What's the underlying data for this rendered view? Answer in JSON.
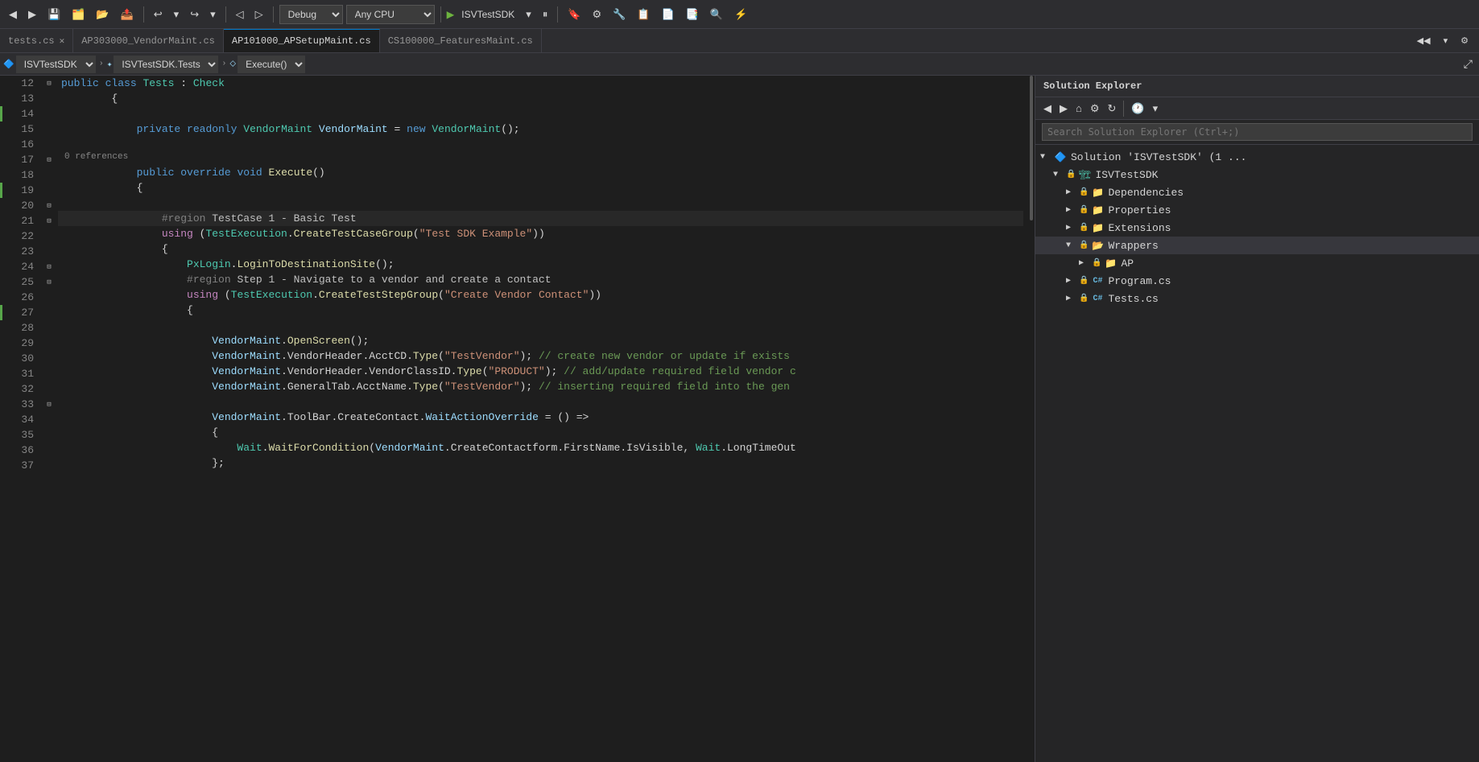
{
  "toolbar": {
    "undo_label": "↩",
    "redo_label": "↪",
    "config_label": "Debug",
    "platform_label": "Any CPU",
    "run_label": "▶",
    "project_label": "ISVTestSDK",
    "save_label": "💾"
  },
  "tabs": [
    {
      "id": "tests",
      "label": "tests.cs",
      "active": false,
      "has_close": true
    },
    {
      "id": "ap303000",
      "label": "AP303000_VendorMaint.cs",
      "active": false,
      "has_close": false
    },
    {
      "id": "ap101000",
      "label": "AP101000_APSetupMaint.cs",
      "active": false,
      "has_close": false
    },
    {
      "id": "cs100000",
      "label": "CS100000_FeaturesMaint.cs",
      "active": false,
      "has_close": false
    }
  ],
  "scope": {
    "project": "ISVTestSDK",
    "class": "ISVTestSDK.Tests",
    "method": "Execute()"
  },
  "solution_explorer": {
    "title": "Solution Explorer",
    "search_placeholder": "Search Solution Explorer (Ctrl+;)",
    "tree": [
      {
        "id": "solution",
        "label": "Solution 'ISVTestSDK' (1 ...",
        "level": 0,
        "type": "solution",
        "expanded": true,
        "locked": false
      },
      {
        "id": "isvtestsdk",
        "label": "ISVTestSDK",
        "level": 1,
        "type": "project",
        "expanded": true,
        "locked": true
      },
      {
        "id": "dependencies",
        "label": "Dependencies",
        "level": 2,
        "type": "folder",
        "expanded": false,
        "locked": true
      },
      {
        "id": "properties",
        "label": "Properties",
        "level": 2,
        "type": "folder",
        "expanded": false,
        "locked": true
      },
      {
        "id": "extensions",
        "label": "Extensions",
        "level": 2,
        "type": "folder",
        "expanded": false,
        "locked": true
      },
      {
        "id": "wrappers",
        "label": "Wrappers",
        "level": 2,
        "type": "folder",
        "expanded": true,
        "locked": true,
        "selected": true
      },
      {
        "id": "ap",
        "label": "AP",
        "level": 3,
        "type": "folder",
        "expanded": false,
        "locked": true
      },
      {
        "id": "program",
        "label": "Program.cs",
        "level": 2,
        "type": "cs",
        "expanded": false,
        "locked": true
      },
      {
        "id": "tests",
        "label": "Tests.cs",
        "level": 2,
        "type": "cs",
        "expanded": false,
        "locked": true
      }
    ]
  },
  "code": {
    "lines": [
      {
        "num": 12,
        "indent": 1,
        "collapse": false,
        "change": "",
        "content": "        public class Tests : Check",
        "tokens": [
          {
            "t": "kw",
            "v": "public"
          },
          {
            "t": "op",
            "v": " "
          },
          {
            "t": "kw",
            "v": "class"
          },
          {
            "t": "op",
            "v": " "
          },
          {
            "t": "type",
            "v": "Tests"
          },
          {
            "t": "op",
            "v": " : "
          },
          {
            "t": "type",
            "v": "Check"
          }
        ]
      },
      {
        "num": 13,
        "indent": 0,
        "collapse": false,
        "change": "",
        "content": "        {",
        "tokens": [
          {
            "t": "op",
            "v": "        {"
          }
        ]
      },
      {
        "num": 14,
        "indent": 0,
        "collapse": false,
        "change": "green",
        "content": "",
        "tokens": []
      },
      {
        "num": 15,
        "indent": 0,
        "collapse": false,
        "change": "",
        "content": "            private readonly VendorMaint VendorMaint = new VendorMaint();",
        "tokens": [
          {
            "t": "kw",
            "v": "            private"
          },
          {
            "t": "op",
            "v": " "
          },
          {
            "t": "kw",
            "v": "readonly"
          },
          {
            "t": "op",
            "v": " "
          },
          {
            "t": "type",
            "v": "VendorMaint"
          },
          {
            "t": "op",
            "v": " "
          },
          {
            "t": "param",
            "v": "VendorMaint"
          },
          {
            "t": "op",
            "v": " = "
          },
          {
            "t": "kw",
            "v": "new"
          },
          {
            "t": "op",
            "v": " "
          },
          {
            "t": "type",
            "v": "VendorMaint"
          },
          {
            "t": "op",
            "v": "();"
          }
        ]
      },
      {
        "num": 16,
        "indent": 0,
        "collapse": false,
        "change": "",
        "content": "",
        "tokens": []
      },
      {
        "num": 17,
        "indent": 1,
        "collapse": false,
        "change": "",
        "content": "            public override void Execute()",
        "ref_count": "0 references",
        "tokens": [
          {
            "t": "kw",
            "v": "            public"
          },
          {
            "t": "op",
            "v": " "
          },
          {
            "t": "kw",
            "v": "override"
          },
          {
            "t": "op",
            "v": " "
          },
          {
            "t": "kw",
            "v": "void"
          },
          {
            "t": "op",
            "v": " "
          },
          {
            "t": "method",
            "v": "Execute"
          },
          {
            "t": "op",
            "v": "()"
          }
        ]
      },
      {
        "num": 18,
        "indent": 0,
        "collapse": false,
        "change": "",
        "content": "            {",
        "tokens": [
          {
            "t": "op",
            "v": "            {"
          }
        ]
      },
      {
        "num": 19,
        "indent": 0,
        "collapse": false,
        "change": "green",
        "content": "",
        "tokens": []
      },
      {
        "num": 20,
        "indent": 1,
        "collapse": true,
        "change": "",
        "content": "                #region TestCase 1 - Basic Test",
        "tokens": [
          {
            "t": "region",
            "v": "                #region"
          },
          {
            "t": "op",
            "v": " "
          },
          {
            "t": "region-name",
            "v": "TestCase 1 - Basic Test"
          }
        ]
      },
      {
        "num": 21,
        "indent": 1,
        "collapse": true,
        "change": "",
        "content": "                using (TestExecution.CreateTestCaseGroup(\"Test SDK Example\"))",
        "tokens": [
          {
            "t": "kw2",
            "v": "                using"
          },
          {
            "t": "op",
            "v": " ("
          },
          {
            "t": "type",
            "v": "TestExecution"
          },
          {
            "t": "op",
            "v": "."
          },
          {
            "t": "method",
            "v": "CreateTestCaseGroup"
          },
          {
            "t": "op",
            "v": "("
          },
          {
            "t": "str",
            "v": "\"Test SDK Example\""
          },
          {
            "t": "op",
            "v": "()))"
          }
        ]
      },
      {
        "num": 22,
        "indent": 0,
        "collapse": false,
        "change": "",
        "content": "                {",
        "tokens": [
          {
            "t": "op",
            "v": "                {"
          }
        ]
      },
      {
        "num": 23,
        "indent": 0,
        "collapse": false,
        "change": "",
        "content": "                    PxLogin.LoginToDestinationSite();",
        "tokens": [
          {
            "t": "type",
            "v": "                    PxLogin"
          },
          {
            "t": "op",
            "v": "."
          },
          {
            "t": "method",
            "v": "LoginToDestinationSite"
          },
          {
            "t": "op",
            "v": "();"
          }
        ]
      },
      {
        "num": 24,
        "indent": 1,
        "collapse": true,
        "change": "",
        "content": "                    #region Step 1 - Navigate to a vendor and create a contact",
        "tokens": [
          {
            "t": "region",
            "v": "                    #region"
          },
          {
            "t": "op",
            "v": " "
          },
          {
            "t": "region-name",
            "v": "Step 1 - Navigate to a vendor and create a contact"
          }
        ]
      },
      {
        "num": 25,
        "indent": 1,
        "collapse": true,
        "change": "",
        "content": "                    using (TestExecution.CreateTestStepGroup(\"Create Vendor Contact\"))",
        "tokens": [
          {
            "t": "kw2",
            "v": "                    using"
          },
          {
            "t": "op",
            "v": " ("
          },
          {
            "t": "type",
            "v": "TestExecution"
          },
          {
            "t": "op",
            "v": "."
          },
          {
            "t": "method",
            "v": "CreateTestStepGroup"
          },
          {
            "t": "op",
            "v": "("
          },
          {
            "t": "str",
            "v": "\"Create Vendor Contact\""
          },
          {
            "t": "op",
            "v": "()))"
          }
        ]
      },
      {
        "num": 26,
        "indent": 0,
        "collapse": false,
        "change": "",
        "content": "                    {",
        "tokens": [
          {
            "t": "op",
            "v": "                    {"
          }
        ]
      },
      {
        "num": 27,
        "indent": 0,
        "collapse": false,
        "change": "green",
        "content": "",
        "tokens": []
      },
      {
        "num": 28,
        "indent": 0,
        "collapse": false,
        "change": "",
        "content": "                        VendorMaint.OpenScreen();",
        "tokens": [
          {
            "t": "param",
            "v": "                        VendorMaint"
          },
          {
            "t": "op",
            "v": "."
          },
          {
            "t": "method",
            "v": "OpenScreen"
          },
          {
            "t": "op",
            "v": "();"
          }
        ]
      },
      {
        "num": 29,
        "indent": 0,
        "collapse": false,
        "change": "",
        "content": "                        VendorMaint.VendorHeader.AcctCD.Type(\"TestVendor\"); // create new vendor or update if exists",
        "tokens": [
          {
            "t": "param",
            "v": "                        VendorMaint"
          },
          {
            "t": "op",
            "v": ".VendorHeader.AcctCD."
          },
          {
            "t": "method",
            "v": "Type"
          },
          {
            "t": "op",
            "v": "("
          },
          {
            "t": "str",
            "v": "\"TestVendor\""
          },
          {
            "t": "op",
            "v": "); "
          },
          {
            "t": "comment",
            "v": "// create new vendor or update if exists"
          }
        ]
      },
      {
        "num": 30,
        "indent": 0,
        "collapse": false,
        "change": "",
        "content": "                        VendorMaint.VendorHeader.VendorClassID.Type(\"PRODUCT\"); // add/update required field vendor c",
        "tokens": [
          {
            "t": "param",
            "v": "                        VendorMaint"
          },
          {
            "t": "op",
            "v": ".VendorHeader.VendorClassID."
          },
          {
            "t": "method",
            "v": "Type"
          },
          {
            "t": "op",
            "v": "("
          },
          {
            "t": "str",
            "v": "\"PRODUCT\""
          },
          {
            "t": "op",
            "v": "); "
          },
          {
            "t": "comment",
            "v": "// add/update required field vendor c"
          }
        ]
      },
      {
        "num": 31,
        "indent": 0,
        "collapse": false,
        "change": "",
        "content": "                        VendorMaint.GeneralTab.AcctName.Type(\"TestVendor\"); // inserting required field into the gen",
        "tokens": [
          {
            "t": "param",
            "v": "                        VendorMaint"
          },
          {
            "t": "op",
            "v": ".GeneralTab.AcctName."
          },
          {
            "t": "method",
            "v": "Type"
          },
          {
            "t": "op",
            "v": "("
          },
          {
            "t": "str",
            "v": "\"TestVendor\""
          },
          {
            "t": "op",
            "v": "); "
          },
          {
            "t": "comment",
            "v": "// inserting required field into the gen"
          }
        ]
      },
      {
        "num": 32,
        "indent": 0,
        "collapse": false,
        "change": "",
        "content": "",
        "tokens": []
      },
      {
        "num": 33,
        "indent": 1,
        "collapse": false,
        "change": "",
        "content": "                        VendorMaint.ToolBar.CreateContact.WaitActionOverride = () =>",
        "tokens": [
          {
            "t": "param",
            "v": "                        VendorMaint"
          },
          {
            "t": "op",
            "v": ".ToolBar.CreateContact."
          },
          {
            "t": "param",
            "v": "WaitActionOverride"
          },
          {
            "t": "op",
            "v": " = () =>"
          }
        ]
      },
      {
        "num": 34,
        "indent": 0,
        "collapse": false,
        "change": "",
        "content": "                        {",
        "tokens": [
          {
            "t": "op",
            "v": "                        {"
          }
        ]
      },
      {
        "num": 35,
        "indent": 0,
        "collapse": false,
        "change": "",
        "content": "                            Wait.WaitForCondition(VendorMaint.CreateContactform.FirstName.IsVisible, Wait.LongTimeOut",
        "tokens": [
          {
            "t": "type",
            "v": "                            Wait"
          },
          {
            "t": "op",
            "v": "."
          },
          {
            "t": "method",
            "v": "WaitForCondition"
          },
          {
            "t": "op",
            "v": "("
          },
          {
            "t": "param",
            "v": "VendorMaint"
          },
          {
            "t": "op",
            "v": ".CreateContactform.FirstName.IsVisible, "
          },
          {
            "t": "type",
            "v": "Wait"
          },
          {
            "t": "op",
            "v": ".LongTimeOut"
          }
        ]
      },
      {
        "num": 36,
        "indent": 0,
        "collapse": false,
        "change": "",
        "content": "                        };",
        "tokens": [
          {
            "t": "op",
            "v": "                        };"
          }
        ]
      },
      {
        "num": 37,
        "indent": 0,
        "collapse": false,
        "change": "",
        "content": "",
        "tokens": []
      }
    ]
  }
}
